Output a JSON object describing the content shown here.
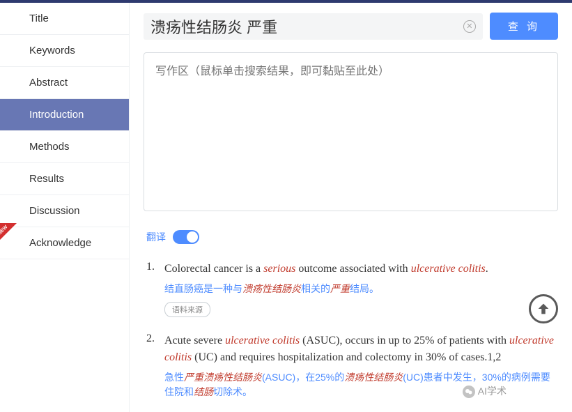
{
  "sidebar": {
    "items": [
      {
        "label": "Title"
      },
      {
        "label": "Keywords"
      },
      {
        "label": "Abstract"
      },
      {
        "label": "Introduction"
      },
      {
        "label": "Methods"
      },
      {
        "label": "Results"
      },
      {
        "label": "Discussion"
      },
      {
        "label": "Acknowledge"
      }
    ],
    "new_badge": "NEW"
  },
  "search": {
    "value": "溃疡性结肠炎 严重",
    "clear_symbol": "✕",
    "button": "查 询"
  },
  "textarea": {
    "placeholder": "写作区（鼠标单击搜索结果，即可黏贴至此处）"
  },
  "translate": {
    "label": "翻译"
  },
  "results": [
    {
      "num": "1.",
      "en_parts": [
        "Colorectal cancer is a ",
        "serious",
        " outcome associated with ",
        "ulcerative colitis",
        "."
      ],
      "cn_parts": [
        "结直肠癌是一种与",
        "溃疡性结肠炎",
        "相关的",
        "严重",
        "结局。"
      ],
      "source_label": "语料来源"
    },
    {
      "num": "2.",
      "en_parts": [
        "Acute severe ",
        "ulcerative colitis",
        " (ASUC), occurs in up to 25% of patients with ",
        "ulcerative colitis",
        " (UC) and requires hospitalization and colectomy in 30% of cases.1,2"
      ],
      "cn_parts": [
        "急性",
        "严重溃疡性结肠炎",
        "(ASUC)，在25%的",
        "溃疡性结肠炎",
        "(UC)患者中发生，30%的病例需要住院和",
        "结肠",
        "切除术。"
      ]
    }
  ],
  "watermark": "AI学术"
}
